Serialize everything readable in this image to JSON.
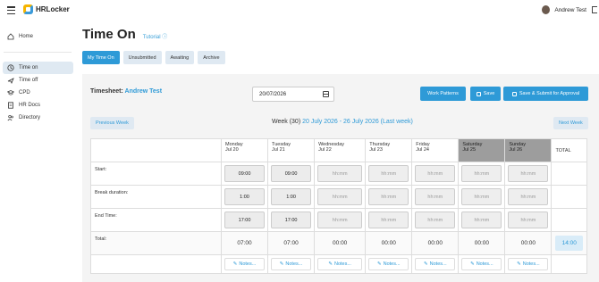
{
  "app": {
    "logo_text": "HRLocker",
    "user_name": "Andrew Test"
  },
  "sidebar": {
    "items": [
      {
        "label": "Home",
        "icon": "home-icon"
      },
      {
        "label": "Time on",
        "icon": "clock-icon",
        "active": true
      },
      {
        "label": "Time off",
        "icon": "plane-icon"
      },
      {
        "label": "CPD",
        "icon": "graduation-cap-icon"
      },
      {
        "label": "HR Docs",
        "icon": "document-icon"
      },
      {
        "label": "Directory",
        "icon": "people-icon"
      }
    ]
  },
  "page": {
    "title": "Time On",
    "tutorial": "Tutorial"
  },
  "tabs": [
    "My Time On",
    "Unsubmitted",
    "Awaiting",
    "Archive"
  ],
  "timesheet": {
    "label": "Timesheet:",
    "employee": "Andrew Test",
    "date": "20/07/2026",
    "work_patterns": "Work Patterns",
    "save": "Save",
    "save_submit": "Save & Submit for Approval",
    "previous_week": "Previous Week",
    "next_week": "Next Week",
    "week_prefix": "Week (30)",
    "week_range": "20 July 2026 - 26 July 2026 (Last week)"
  },
  "grid": {
    "days": [
      {
        "name": "Monday",
        "date": "Jul 20",
        "weekend": false,
        "start": "09:00",
        "break": "1:00",
        "end": "17:00",
        "total": "07:00"
      },
      {
        "name": "Tuesday",
        "date": "Jul 21",
        "weekend": false,
        "start": "09:00",
        "break": "1:00",
        "end": "17:00",
        "total": "07:00"
      },
      {
        "name": "Wednesday",
        "date": "Jul 22",
        "weekend": false,
        "start": "hh:mm",
        "break": "hh:mm",
        "end": "hh:mm",
        "total": "00:00"
      },
      {
        "name": "Thursday",
        "date": "Jul 23",
        "weekend": false,
        "start": "hh:mm",
        "break": "hh:mm",
        "end": "hh:mm",
        "total": "00:00"
      },
      {
        "name": "Friday",
        "date": "Jul 24",
        "weekend": false,
        "start": "hh:mm",
        "break": "hh:mm",
        "end": "hh:mm",
        "total": "00:00"
      },
      {
        "name": "Saturday",
        "date": "Jul 25",
        "weekend": true,
        "start": "hh:mm",
        "break": "hh:mm",
        "end": "hh:mm",
        "total": "00:00"
      },
      {
        "name": "Sunday",
        "date": "Jul 26",
        "weekend": true,
        "start": "hh:mm",
        "break": "hh:mm",
        "end": "hh:mm",
        "total": "00:00"
      }
    ],
    "total_header": "TOTAL",
    "row_labels": {
      "start": "Start:",
      "break": "Break duration:",
      "end": "End Time:",
      "total": "Total:"
    },
    "week_total": "14:00",
    "notes_label": "Notes..."
  }
}
